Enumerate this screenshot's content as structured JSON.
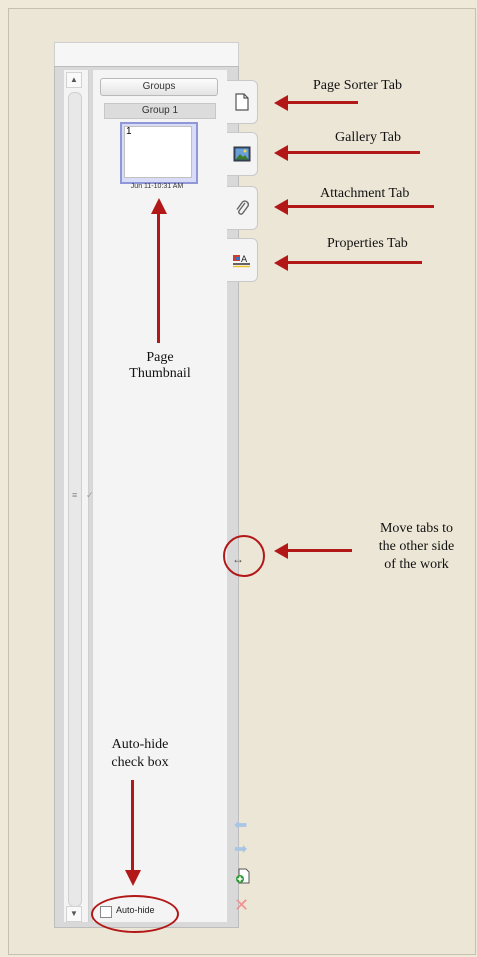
{
  "panel": {
    "groups_button": "Groups",
    "group_label": "Group 1",
    "thumbnail": {
      "page_number": "1",
      "date": "Jun 11-10:31 AM"
    },
    "autohide_label": "Auto-hide",
    "move_tabs_glyph": "↔"
  },
  "tabs": [
    {
      "name": "page-sorter",
      "icon": "page-icon"
    },
    {
      "name": "gallery",
      "icon": "picture-icon"
    },
    {
      "name": "attachment",
      "icon": "paperclip-icon"
    },
    {
      "name": "properties",
      "icon": "properties-icon"
    }
  ],
  "callouts": {
    "page_sorter": "Page Sorter Tab",
    "gallery": "Gallery Tab",
    "attachment": "Attachment Tab",
    "properties": "Properties Tab",
    "thumbnail_line1": "Page",
    "thumbnail_line2": "Thumbnail",
    "move_line1": "Move tabs to",
    "move_line2": "the other side",
    "move_line3": "of the work",
    "autohide_line1": "Auto-hide",
    "autohide_line2": "check box"
  },
  "colors": {
    "annotation_red": "#b21818",
    "thumb_border": "#8f97d8"
  }
}
